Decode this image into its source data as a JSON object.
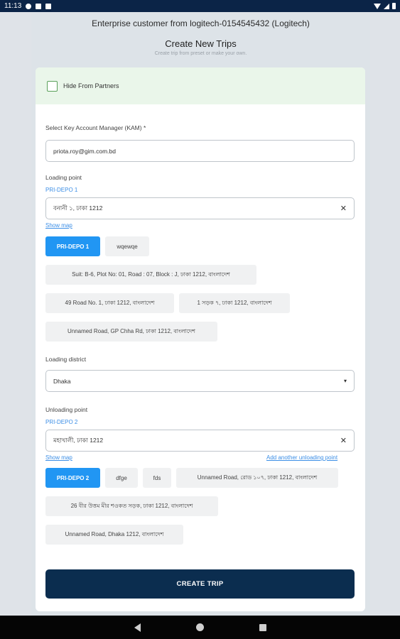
{
  "status": {
    "time": "11:13"
  },
  "header": {
    "customer": "Enterprise customer from logitech-0154545432 (Logitech)",
    "title": "Create New Trips",
    "subtitle": "Create trip from preset or make your own."
  },
  "form": {
    "hide_label": "Hide From Partners",
    "kam_label": "Select Key Account Manager (KAM) *",
    "kam_value": "priota.roy@gim.com.bd",
    "loading_label": "Loading point",
    "loading_depot": "PRI-DEPO 1",
    "loading_value": "বনানী ১, ঢাকা 1212",
    "show_map": "Show map",
    "loading_chips": [
      "PRI-DEPO 1",
      "wqewqe",
      "Suit: B-6, Plot No: 01, Road : 07, Block : J, ঢাকা 1212, বাংলাদেশ",
      "49 Road No. 1, ঢাকা 1212, বাংলাদেশ",
      "1 সড়ক ৭, ঢাকা 1212, বাংলাদেশ",
      "Unnamed Road, GP Chha Rd, ঢাকা 1212, বাংলাদেশ"
    ],
    "district_label": "Loading district",
    "district_value": "Dhaka",
    "unloading_label": "Unloading point",
    "unloading_depot": "PRI-DEPO 2",
    "unloading_value": "মহাখালী, ঢাকা 1212",
    "add_unloading": "Add another unloading point",
    "unloading_chips": [
      "PRI-DEPO 2",
      "dfge",
      "fds",
      "Unnamed Road, রোড ১০৭, ঢাকা 1212, বাংলাদেশ",
      "26 বীর উত্তম মীর শওকত সড়ক, ঢাকা 1212, বাংলাদেশ",
      "Unnamed Road, Dhaka 1212, বাংলাদেশ"
    ],
    "create_button": "CREATE TRIP"
  }
}
